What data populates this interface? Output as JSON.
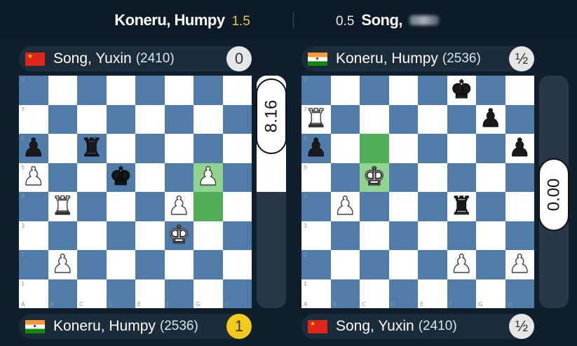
{
  "header": {
    "left_player": "Koneru, Humpy",
    "left_score": "1.5",
    "right_score": "0.5",
    "right_player": "Song, "
  },
  "boards": [
    {
      "top_player": {
        "name": "Song, Yuxin",
        "rating": "(2410)",
        "score": "0",
        "flag": "china-flag",
        "score_color": "#e6e6e6"
      },
      "bottom_player": {
        "name": "Koneru, Humpy",
        "rating": "(2536)",
        "score": "1",
        "flag": "india-flag",
        "score_color": "#f2cb1a"
      },
      "highlight_squares": [
        "g5",
        "g4"
      ],
      "pieces": [
        {
          "square": "a6",
          "color": "b",
          "type": "pawn",
          "glyph": "♟"
        },
        {
          "square": "c6",
          "color": "b",
          "type": "rook",
          "glyph": "♜"
        },
        {
          "square": "d5",
          "color": "b",
          "type": "king",
          "glyph": "♚"
        },
        {
          "square": "a5",
          "color": "w",
          "type": "pawn",
          "glyph": "♟"
        },
        {
          "square": "g5",
          "color": "w",
          "type": "pawn",
          "glyph": "♟"
        },
        {
          "square": "b4",
          "color": "w",
          "type": "rook",
          "glyph": "♜"
        },
        {
          "square": "f4",
          "color": "w",
          "type": "pawn",
          "glyph": "♟"
        },
        {
          "square": "f3",
          "color": "w",
          "type": "king",
          "glyph": "♚"
        },
        {
          "square": "b2",
          "color": "w",
          "type": "pawn",
          "glyph": "♟"
        }
      ],
      "evaluation": "8.16",
      "eval_white_fraction": 0.5
    },
    {
      "top_player": {
        "name": "Koneru, Humpy",
        "rating": "(2536)",
        "score": "½",
        "flag": "india-flag",
        "score_color": "#e6e6e6"
      },
      "bottom_player": {
        "name": "Song, Yuxin",
        "rating": "(2410)",
        "score": "½",
        "flag": "china-flag",
        "score_color": "#e6e6e6"
      },
      "highlight_squares": [
        "c6",
        "c5"
      ],
      "pieces": [
        {
          "square": "f8",
          "color": "b",
          "type": "king",
          "glyph": "♚"
        },
        {
          "square": "a7",
          "color": "w",
          "type": "rook",
          "glyph": "♜"
        },
        {
          "square": "g7",
          "color": "b",
          "type": "pawn",
          "glyph": "♟"
        },
        {
          "square": "a6",
          "color": "b",
          "type": "pawn",
          "glyph": "♟"
        },
        {
          "square": "h6",
          "color": "b",
          "type": "pawn",
          "glyph": "♟"
        },
        {
          "square": "c5",
          "color": "w",
          "type": "king",
          "glyph": "♚"
        },
        {
          "square": "b4",
          "color": "w",
          "type": "pawn",
          "glyph": "♟"
        },
        {
          "square": "f4",
          "color": "b",
          "type": "rook",
          "glyph": "♜"
        },
        {
          "square": "f2",
          "color": "w",
          "type": "pawn",
          "glyph": "♟"
        },
        {
          "square": "h2",
          "color": "w",
          "type": "pawn",
          "glyph": "♟"
        }
      ],
      "evaluation": "0.00",
      "eval_white_fraction": 0
    }
  ]
}
